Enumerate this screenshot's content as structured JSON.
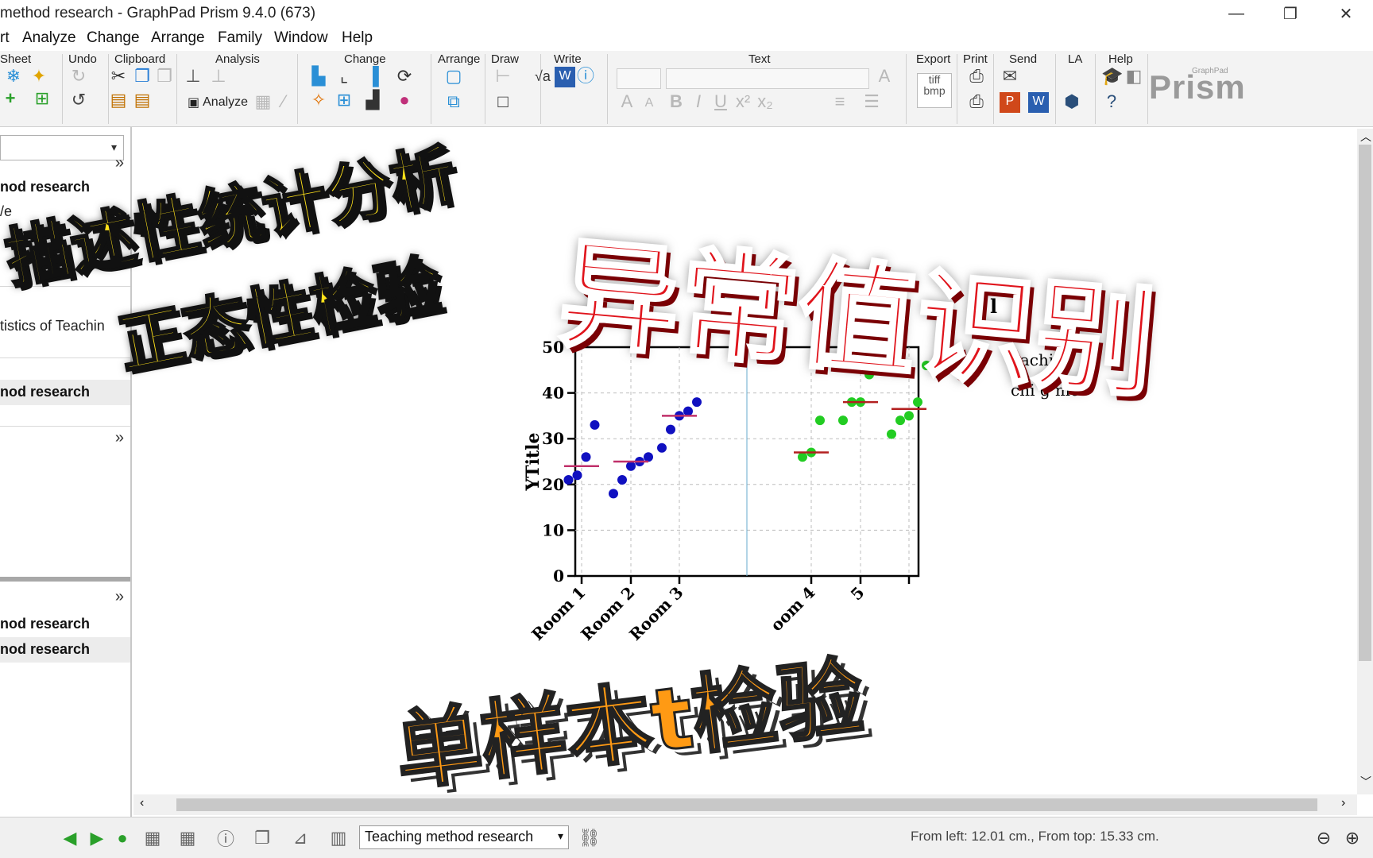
{
  "window": {
    "title": "method research - GraphPad Prism 9.4.0 (673)",
    "controls": [
      "—",
      "❐",
      "✕"
    ]
  },
  "menu": [
    "rt",
    "Analyze",
    "Change",
    "Arrange",
    "Family",
    "Window",
    "Help"
  ],
  "ribbon": {
    "groups": [
      "Sheet",
      "Undo",
      "Clipboard",
      "Analysis",
      "Change",
      "Arrange",
      "Draw",
      "Write",
      "Text",
      "Export",
      "Print",
      "Send",
      "LA",
      "Help"
    ],
    "analyze_label": "Analyze",
    "export_icon_text": [
      "tiff",
      "bmp"
    ],
    "logo_sub": "GraphPad",
    "logo": "Prism"
  },
  "navigator": {
    "items": [
      {
        "text": "nod research",
        "bold": true,
        "selected": false
      },
      {
        "text": "/e",
        "bold": false,
        "selected": false
      },
      {
        "text": "tistics of Teachin",
        "bold": false,
        "selected": false
      },
      {
        "text": "nod research",
        "bold": true,
        "selected": true
      },
      {
        "text": "nod research",
        "bold": true,
        "selected": false
      },
      {
        "text": "nod research",
        "bold": true,
        "selected": true
      }
    ],
    "expand_glyph": "»"
  },
  "graph": {
    "title_partial": "g me",
    "title_partial_2": "l",
    "legend": [
      "eachi",
      "chi g me"
    ]
  },
  "chart_data": {
    "type": "scatter",
    "title": "",
    "xlabel": "",
    "ylabel": "YTitle",
    "ylim": [
      0,
      50
    ],
    "yticks": [
      0,
      10,
      20,
      30,
      40,
      50
    ],
    "categories": [
      "Room 1",
      "Room 2",
      "Room 3",
      "oom 4",
      "5",
      ""
    ],
    "grid": true,
    "series": [
      {
        "color": "#1010c0",
        "mean_color": "#c0306a",
        "groups": [
          {
            "category": "Room 1",
            "points": [
              21,
              22,
              26,
              33
            ],
            "mean": 24
          },
          {
            "category": "Room 2",
            "points": [
              18,
              21,
              24,
              25,
              26
            ],
            "mean": 25
          },
          {
            "category": "Room 3",
            "points": [
              28,
              32,
              35,
              36,
              38
            ],
            "mean": 35
          }
        ]
      },
      {
        "color": "#22cc22",
        "mean_color": "#b32020",
        "groups": [
          {
            "category": "oom 4",
            "points": [
              26,
              27,
              34
            ],
            "mean": 27
          },
          {
            "category": "5",
            "points": [
              34,
              38,
              38,
              44,
              45
            ],
            "mean": 38
          },
          {
            "category": "",
            "points": [
              31,
              34,
              35,
              38,
              46
            ],
            "mean": 36.5
          }
        ]
      }
    ]
  },
  "overlays": {
    "line1": "描述性统计分析",
    "line2": "正态性检验",
    "red": "异常值识别",
    "bottom": "单样本t检验"
  },
  "statusbar": {
    "sheet_select": "Teaching method research",
    "position": "From left: 12.01 cm., From top: 15.33 cm."
  }
}
